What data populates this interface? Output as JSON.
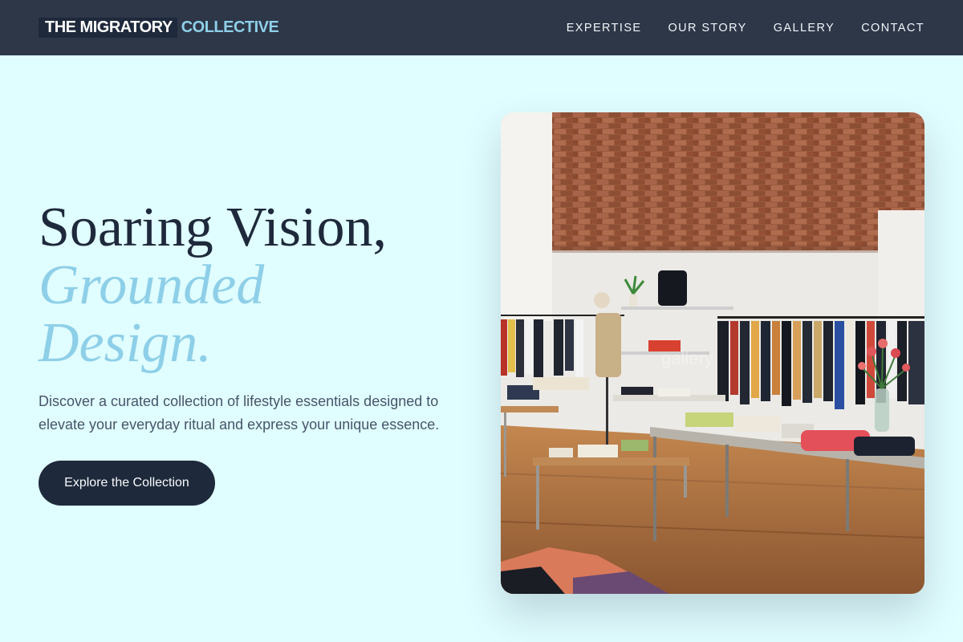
{
  "brand": {
    "name_primary": "THE MIGRATORY",
    "name_accent": "COLLECTIVE"
  },
  "nav": {
    "items": [
      "EXPERTISE",
      "OUR STORY",
      "GALLERY",
      "CONTACT"
    ]
  },
  "hero": {
    "headline_line1": "Soaring Vision,",
    "headline_line2": "Grounded",
    "headline_line3": "Design.",
    "description": "Discover a curated collection of lifestyle essentials designed to elevate your everyday ritual and express your unique essence.",
    "cta_label": "Explore the Collection"
  },
  "image": {
    "subject": "clothing-boutique-interior-photo",
    "watermark": "gallery"
  },
  "colors": {
    "page_bg": "#e0fdff",
    "header_bg": "#2d3748",
    "accent": "#8ecfe8",
    "dark": "#1e293b"
  }
}
